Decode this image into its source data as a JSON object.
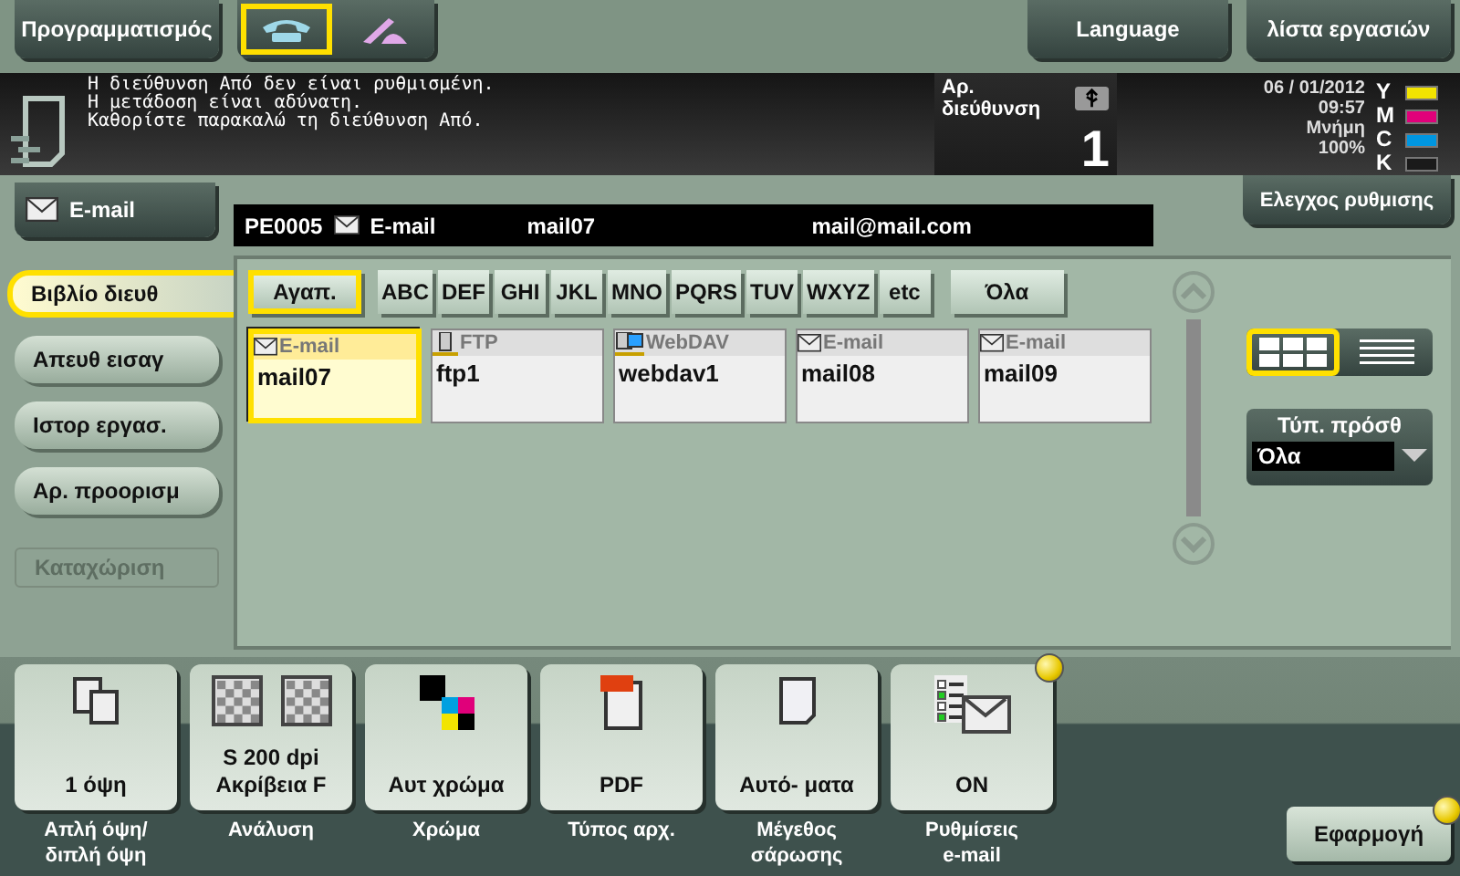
{
  "top_bar": {
    "program_button": "Προγραμματισμός",
    "modes": [
      {
        "kind": "phone",
        "selected": true
      },
      {
        "kind": "handset",
        "selected": false
      }
    ],
    "language_button": "Language",
    "job_list_button": "λίστα εργασιών"
  },
  "status": {
    "message": [
      "Η διεύθυνση Από δεν είναι ρυθμισμένη.",
      "Η μετάδοση είναι αδύνατη.",
      "Καθορίστε παρακαλώ τη διεύθυνση Από."
    ],
    "address_label": "Αρ. διεύθυνση",
    "address_count": "1",
    "date": "06 / 01/2012",
    "time": "09:57",
    "memory_label": "Μνήμη",
    "memory_value": "100%",
    "toners": [
      {
        "label": "Y",
        "color": "#f2e400",
        "level": 1
      },
      {
        "label": "M",
        "color": "#e0007a",
        "level": 1
      },
      {
        "label": "C",
        "color": "#0096e0",
        "level": 1
      },
      {
        "label": "K",
        "color": "#1a1a1a",
        "level": 1
      }
    ]
  },
  "mode_button": "E-mail",
  "destination_bar": {
    "id": "PE0005",
    "type": "E-mail",
    "name": "mail07",
    "address": "mail@mail.com"
  },
  "check_settings_button": "Ελεγχος ρυθμισης",
  "side_tabs": [
    {
      "label": "Βιβλίο διευθ",
      "selected": true,
      "disabled": false
    },
    {
      "label": "Απευθ εισαγ",
      "selected": false,
      "disabled": false
    },
    {
      "label": "Ιστορ εργασ.",
      "selected": false,
      "disabled": false
    },
    {
      "label": "Αρ. προορισμ",
      "selected": false,
      "disabled": false
    },
    {
      "label": "Καταχώριση",
      "selected": false,
      "disabled": true
    }
  ],
  "index_tabs": [
    {
      "label": "Αγαπ.",
      "selected": true
    },
    {
      "label": "ABC",
      "selected": false
    },
    {
      "label": "DEF",
      "selected": false
    },
    {
      "label": "GHI",
      "selected": false
    },
    {
      "label": "JKL",
      "selected": false
    },
    {
      "label": "MNO",
      "selected": false
    },
    {
      "label": "PQRS",
      "selected": false
    },
    {
      "label": "TUV",
      "selected": false
    },
    {
      "label": "WXYZ",
      "selected": false
    },
    {
      "label": "etc",
      "selected": false
    },
    {
      "label": "Όλα",
      "selected": false
    }
  ],
  "entries": [
    {
      "kind": "email",
      "type": "E-mail",
      "name": "mail07",
      "selected": true
    },
    {
      "kind": "ftp",
      "type": "FTP",
      "name": "ftp1",
      "selected": false
    },
    {
      "kind": "webdav",
      "type": "WebDAV",
      "name": "webdav1",
      "selected": false
    },
    {
      "kind": "email",
      "type": "E-mail",
      "name": "mail08",
      "selected": false
    },
    {
      "kind": "email",
      "type": "E-mail",
      "name": "mail09",
      "selected": false
    }
  ],
  "view_modes": [
    {
      "kind": "grid",
      "selected": true
    },
    {
      "kind": "list",
      "selected": false
    }
  ],
  "destination_type": {
    "label": "Τύπ. πρόσθ",
    "value": "Όλα"
  },
  "settings": [
    {
      "kind": "duplex",
      "value": [
        "1 όψη"
      ],
      "label": [
        "Απλή όψη/",
        "διπλή όψη"
      ],
      "notice": false
    },
    {
      "kind": "resolution",
      "value": [
        "S 200 dpi",
        "Ακρίβεια F"
      ],
      "label": [
        "Ανάλυση"
      ],
      "notice": false
    },
    {
      "kind": "color",
      "value": [
        "Αυτ χρώμα"
      ],
      "label": [
        "Χρώμα"
      ],
      "notice": false
    },
    {
      "kind": "file_type",
      "value": [
        "PDF"
      ],
      "label": [
        "Τύπος αρχ."
      ],
      "notice": false
    },
    {
      "kind": "scan_size",
      "value": [
        "Αυτό- ματα"
      ],
      "label": [
        "Μέγεθος",
        "σάρωσης"
      ],
      "notice": false
    },
    {
      "kind": "email_settings",
      "value": [
        "ON"
      ],
      "label": [
        "Ρυθμίσεις",
        "e-mail"
      ],
      "notice": true
    }
  ],
  "apply_button": {
    "label": "Εφαρμογή",
    "notice": true
  }
}
